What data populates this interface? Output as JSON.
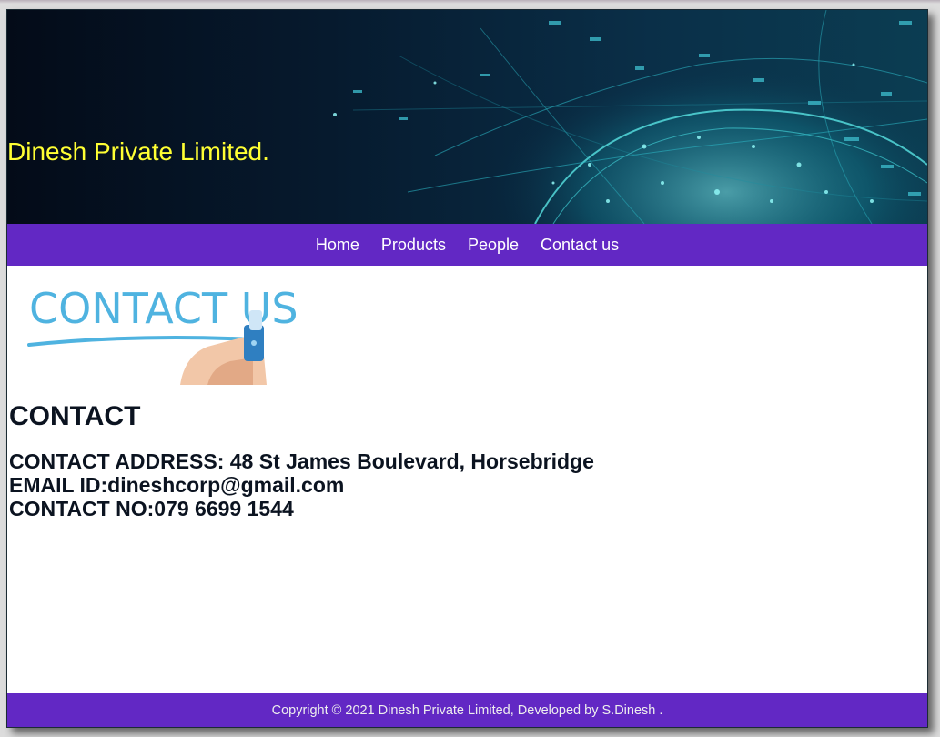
{
  "header": {
    "company_name": "Dinesh Private Limited."
  },
  "nav": {
    "items": [
      {
        "label": "Home"
      },
      {
        "label": "Products"
      },
      {
        "label": "People"
      },
      {
        "label": "Contact us"
      }
    ]
  },
  "main": {
    "contact_image_text": "CONTACT US",
    "heading": "CONTACT",
    "address_line": "CONTACT ADDRESS: 48 St James Boulevard, Horsebridge",
    "email_line": "EMAIL ID:dineshcorp@gmail.com",
    "phone_line": "CONTACT NO:079 6699 1544"
  },
  "footer": {
    "copyright": "Copyright © 2021 Dinesh Private Limited, Developed by S.Dinesh ."
  },
  "colors": {
    "nav_background": "#6228c4",
    "company_name_color": "#ffff33",
    "banner_globe": "#3fd6d6"
  }
}
